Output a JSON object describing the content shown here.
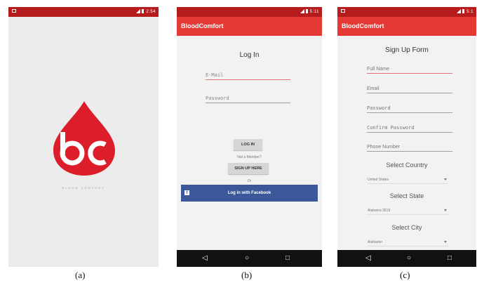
{
  "splash": {
    "status_time": "2:54",
    "tagline": "BLOOD COMFORT",
    "logo_color": "#dc1e2a"
  },
  "login": {
    "status_time": "5:11",
    "app_title": "BloodComfort",
    "title": "Log In",
    "email_placeholder": "E-Mail",
    "password_placeholder": "Password",
    "login_button": "LOG IN",
    "not_member": "Not a Member?",
    "signup_button": "SIGN UP HERE",
    "or_text": "Or",
    "facebook_button": "Log in with Facebook",
    "facebook_icon_glyph": "f"
  },
  "signup": {
    "status_time": "5:1",
    "app_title": "BloodComfort",
    "title": "Sign Up Form",
    "full_name": "Full Name",
    "email": "Email",
    "password": "Password",
    "confirm_password": "Confirm Password",
    "phone": "Phone Number",
    "select_country": "Select Country",
    "country_value": "United States",
    "select_state": "Select State",
    "state_value": "Alabama 3519",
    "select_city": "Select City",
    "city_value": "Alabaster"
  },
  "nav": {
    "back": "◁",
    "home": "○",
    "recents": "□"
  },
  "captions": {
    "a": "(a)",
    "b": "(b)",
    "c": "(c)"
  },
  "colors": {
    "status_bar": "#b71c1c",
    "app_bar": "#e53935",
    "facebook": "#3b5998",
    "focus_underline": "#e57373"
  }
}
